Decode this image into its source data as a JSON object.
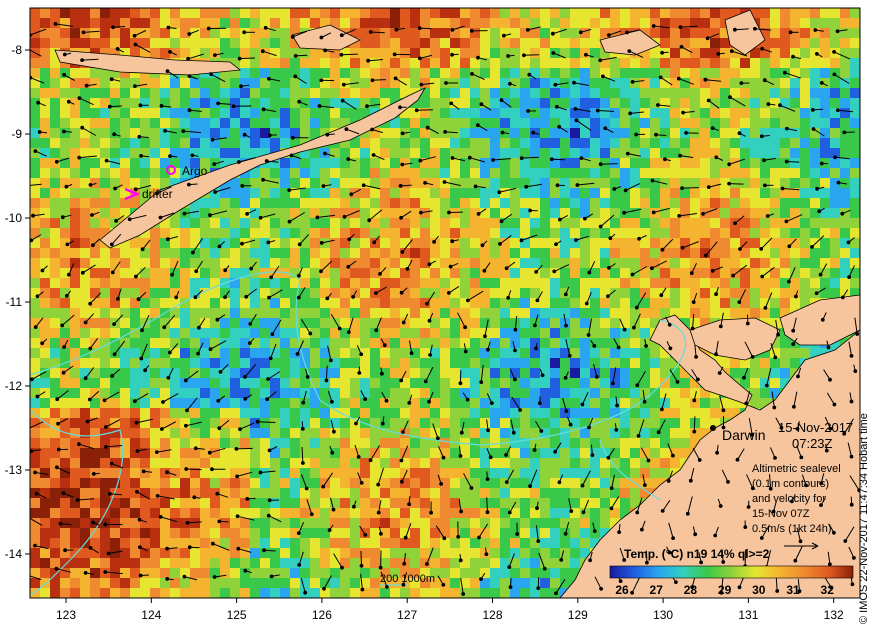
{
  "map": {
    "place_label": "Darwin",
    "date": "15-Nov-2017",
    "time": "07:23Z",
    "altimetry_note": [
      "Altimetric sealevel",
      "(0.1m contours)",
      "and velocity for",
      "15-Nov 07Z",
      "0.5m/s (1kt 24h)"
    ],
    "legend_markers": [
      {
        "label": "Argo",
        "color": "#ff00ff",
        "shape": "circle"
      },
      {
        "label": "drifter",
        "color": "#ff00ff",
        "shape": "chevron"
      }
    ],
    "depth_contour_label": "200  1000m",
    "credit": "© IMOS 22-Nov-2017 11:47:34 Hobart time",
    "colorbar": {
      "title": "Temp. (°C) n19 14% ql>=2",
      "ticks": [
        "26",
        "27",
        "28",
        "29",
        "30",
        "31",
        "32"
      ],
      "colors": [
        "#1a1aa0",
        "#1f5fe0",
        "#2aa6f0",
        "#33d0c0",
        "#3ac84a",
        "#8fd23a",
        "#e6e630",
        "#f4b430",
        "#f08a30",
        "#e05a20",
        "#b83010",
        "#8a2008"
      ]
    },
    "x_axis_ticks": [
      "123",
      "124",
      "125",
      "126",
      "127",
      "128",
      "129",
      "130",
      "131",
      "132"
    ],
    "y_axis_ticks": [
      "-8",
      "-9",
      "-10",
      "-11",
      "-12",
      "-13",
      "-14"
    ],
    "colors": {
      "land": "#f6c59d",
      "ocean_base": "#7cc832",
      "contour": "#66dddd",
      "marker": "#ff00ff"
    }
  }
}
